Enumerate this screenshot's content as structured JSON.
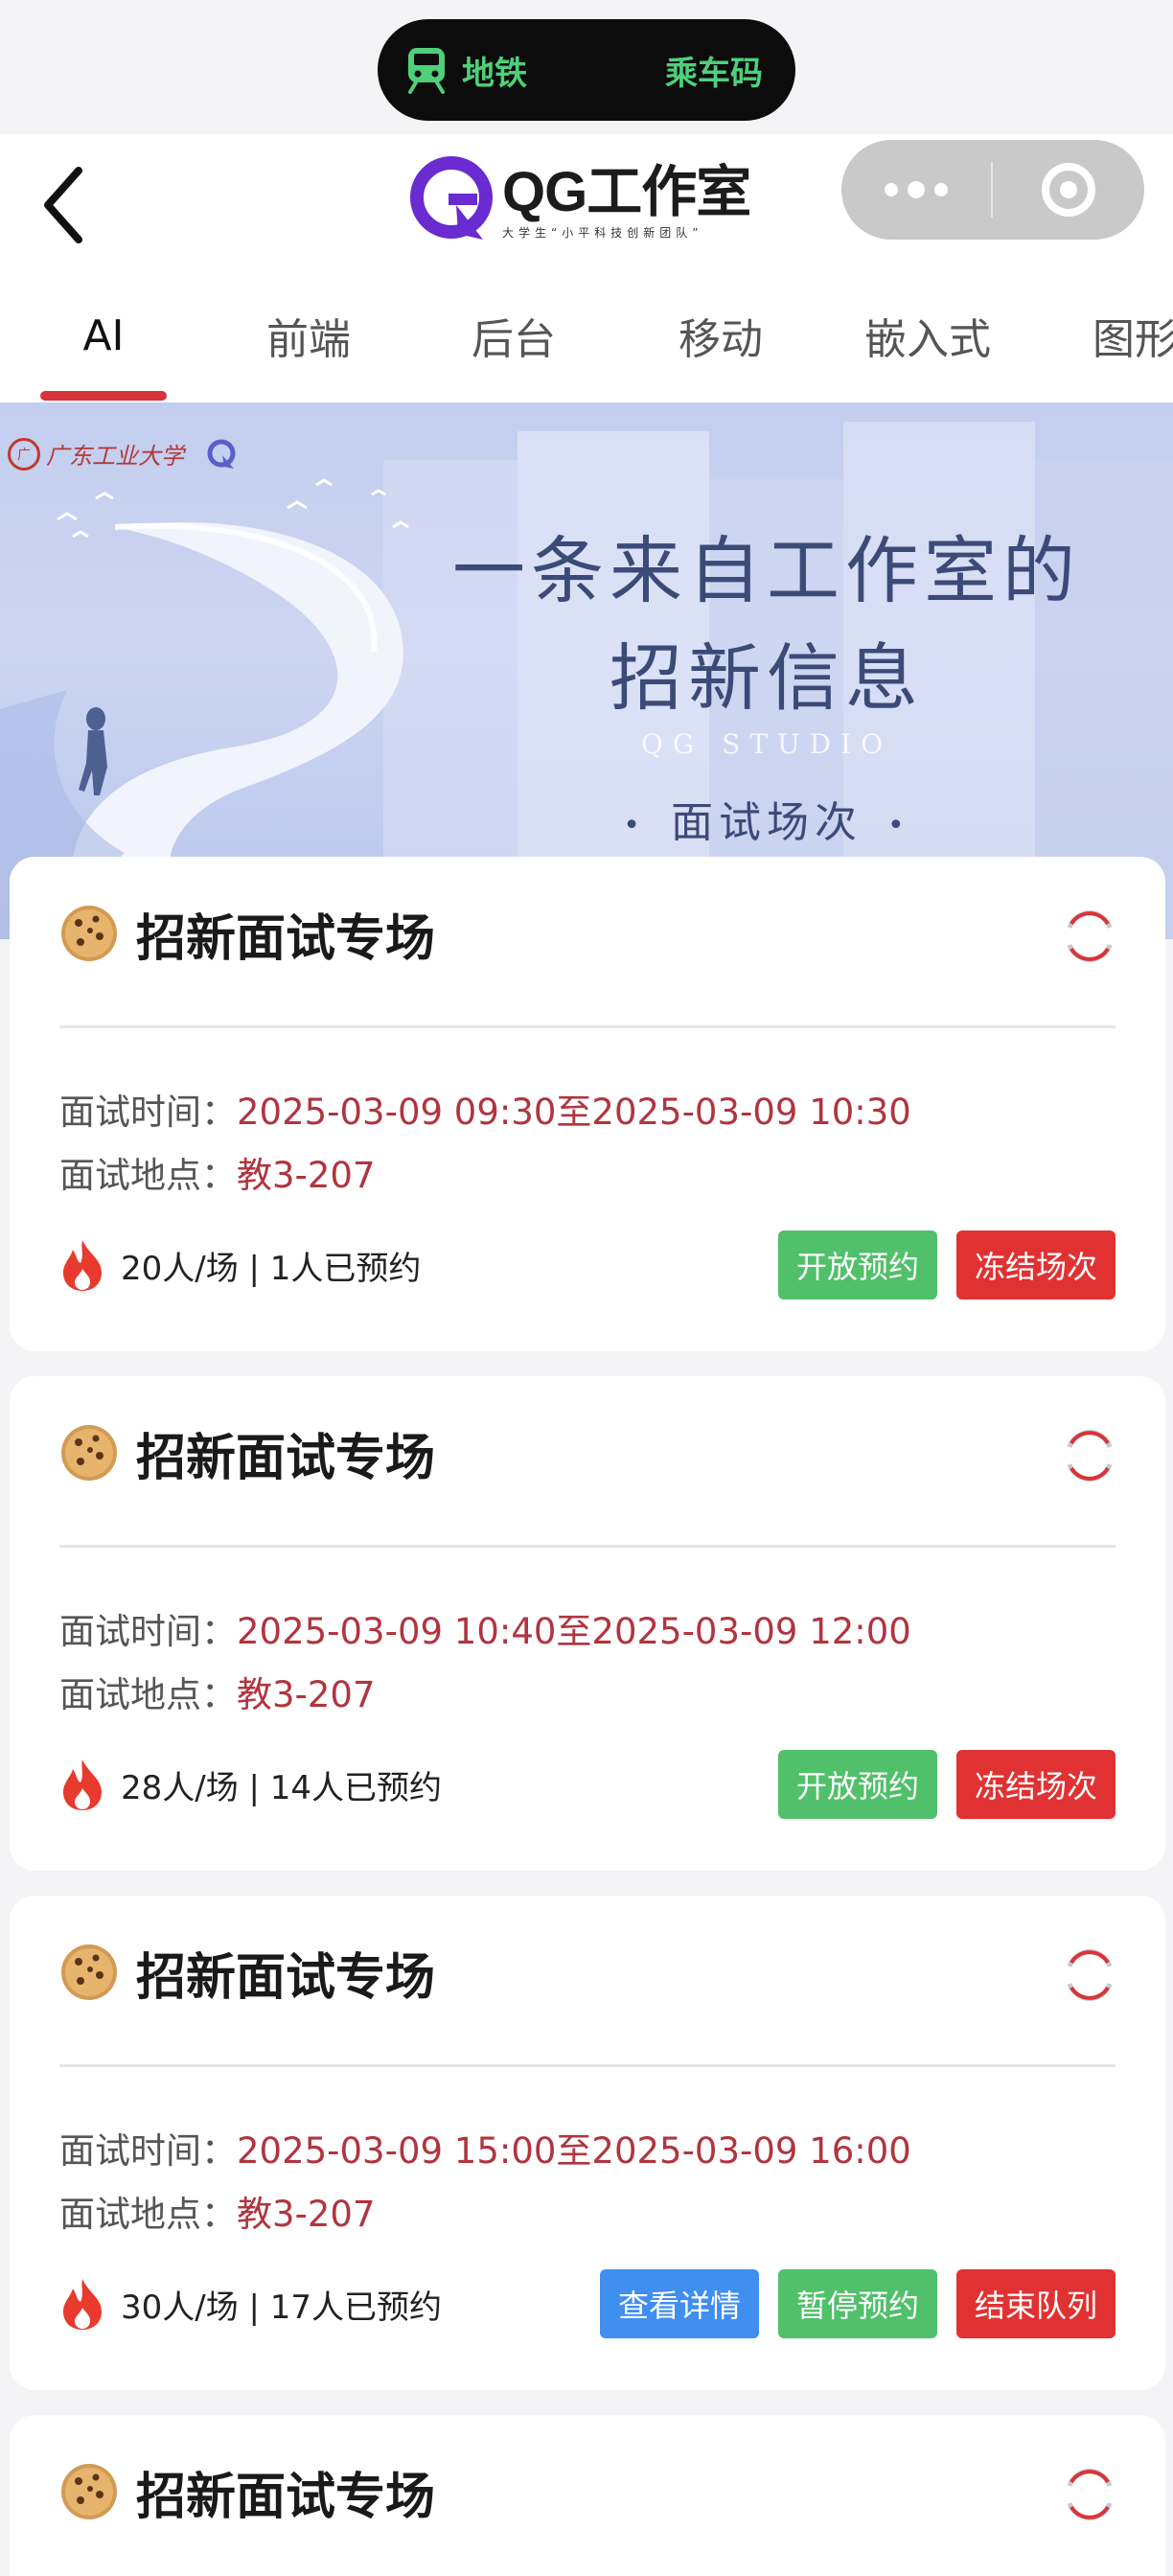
{
  "status_island": {
    "left_label": "地铁",
    "right_label": "乘车码",
    "icon": "train-icon"
  },
  "header": {
    "logo_text": "QG工作室",
    "logo_subtext": "大学生“小平科技创新团队”",
    "capsule_icons": [
      "more-icon",
      "close-miniprogram-icon"
    ]
  },
  "tabs": [
    {
      "label": "AI",
      "active": true
    },
    {
      "label": "前端",
      "active": false
    },
    {
      "label": "后台",
      "active": false
    },
    {
      "label": "移动",
      "active": false
    },
    {
      "label": "嵌入式",
      "active": false
    },
    {
      "label": "图形",
      "active": false
    }
  ],
  "banner": {
    "school_name": "广东工业大学",
    "title_line1": "一条来自工作室的",
    "title_line2": "招新信息",
    "studio": "QG STUDIO",
    "session": "面试场次",
    "colors": {
      "background": "#c3cdee",
      "text": "#3c4a78"
    }
  },
  "sessions": [
    {
      "title": "招新面试专场",
      "time_label": "面试时间：",
      "time_value": "2025-03-09 09:30至2025-03-09 10:30",
      "place_label": "面试地点：",
      "place_value": "教3-207",
      "stats": "20人/场 | 1人已预约",
      "buttons": [
        {
          "label": "开放预约",
          "color": "#51c06a"
        },
        {
          "label": "冻结场次",
          "color": "#e03232"
        }
      ]
    },
    {
      "title": "招新面试专场",
      "time_label": "面试时间：",
      "time_value": "2025-03-09 10:40至2025-03-09 12:00",
      "place_label": "面试地点：",
      "place_value": "教3-207",
      "stats": "28人/场 | 14人已预约",
      "buttons": [
        {
          "label": "开放预约",
          "color": "#51c06a"
        },
        {
          "label": "冻结场次",
          "color": "#e03232"
        }
      ]
    },
    {
      "title": "招新面试专场",
      "time_label": "面试时间：",
      "time_value": "2025-03-09 15:00至2025-03-09 16:00",
      "place_label": "面试地点：",
      "place_value": "教3-207",
      "stats": "30人/场 | 17人已预约",
      "buttons": [
        {
          "label": "查看详情",
          "color": "#3f8ef0"
        },
        {
          "label": "暂停预约",
          "color": "#51c06a"
        },
        {
          "label": "结束队列",
          "color": "#e03232"
        }
      ]
    },
    {
      "title": "招新面试专场"
    }
  ],
  "colors": {
    "accent": "#d9333a",
    "value_text": "#b0353f"
  }
}
